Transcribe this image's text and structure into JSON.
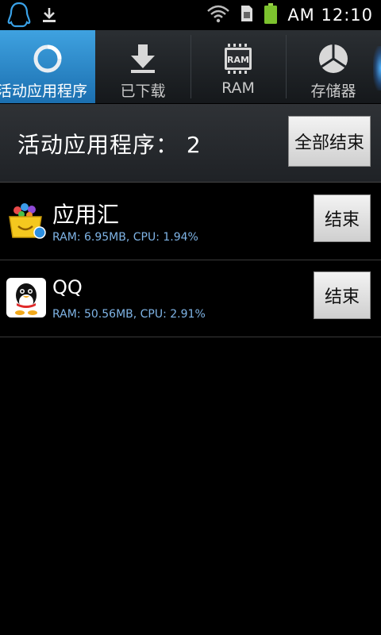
{
  "status_bar": {
    "time": "AM 12:10",
    "icons": [
      "qq-notification-icon",
      "download-icon",
      "wifi-icon",
      "sim-icon",
      "battery-icon"
    ]
  },
  "tabs": [
    {
      "label": "活动应用程序",
      "icon": "running-apps-icon",
      "active": true
    },
    {
      "label": "已下载",
      "icon": "download-arrow-icon",
      "active": false
    },
    {
      "label": "RAM",
      "icon": "ram-chip-icon",
      "icon_text": "RAM",
      "active": false
    },
    {
      "label": "存储器",
      "icon": "storage-pie-icon",
      "active": false
    }
  ],
  "header": {
    "title": "活动应用程序： 2",
    "end_all_label": "全部结束"
  },
  "apps": [
    {
      "name": "应用汇",
      "stats": "RAM: 6.95MB, CPU: 1.94%",
      "end_label": "结束",
      "icon": "appchina-icon"
    },
    {
      "name": "QQ",
      "stats": "RAM: 50.56MB, CPU: 2.91%",
      "end_label": "结束",
      "icon": "qq-penguin-icon"
    }
  ],
  "colors": {
    "active_tab": "#2f8fd6",
    "stats_text": "#7fb4e6",
    "background": "#000000"
  }
}
